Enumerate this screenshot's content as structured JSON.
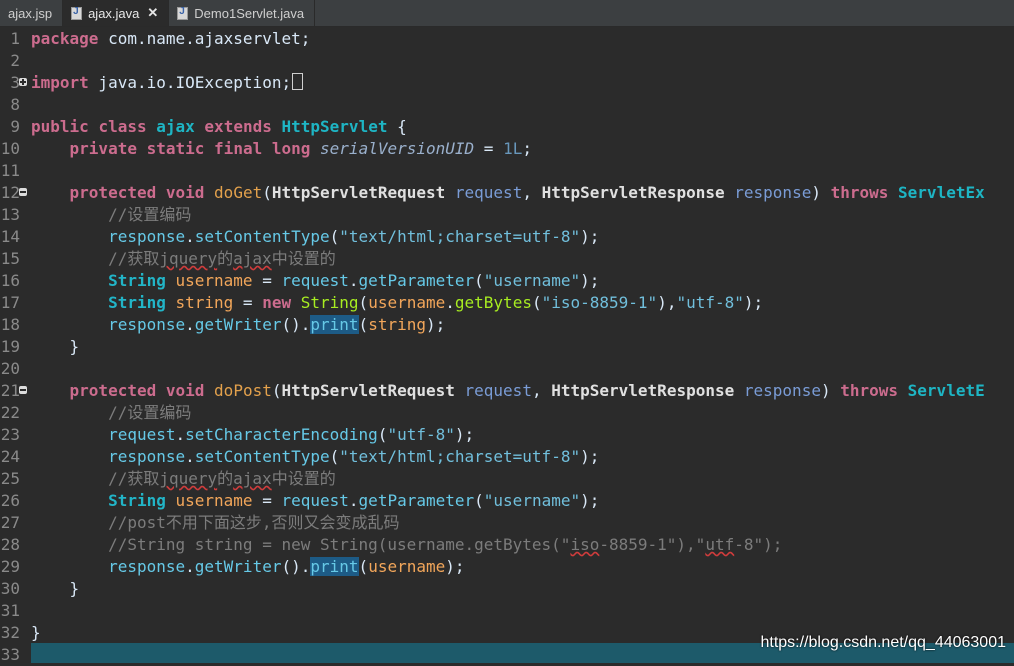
{
  "tabs": [
    {
      "label": "ajax.jsp",
      "active": false
    },
    {
      "label": "ajax.java",
      "active": true
    },
    {
      "label": "Demo1Servlet.java",
      "active": false
    }
  ],
  "line_numbers": [
    "1",
    "2",
    "3",
    "8",
    "9",
    "10",
    "11",
    "12",
    "13",
    "14",
    "15",
    "16",
    "17",
    "18",
    "19",
    "20",
    "21",
    "22",
    "23",
    "24",
    "25",
    "26",
    "27",
    "28",
    "29",
    "30",
    "31",
    "32",
    "33"
  ],
  "code": {
    "package_kw": "package",
    "package_name": " com.name.ajaxservlet;",
    "import_kw": "import",
    "import_name": " java.io.IOException;",
    "public_kw": "public",
    "class_kw": "class",
    "class_name": "ajax",
    "extends_kw": "extends",
    "super_class": "HttpServlet",
    "open_brace": " {",
    "private_kw": "private",
    "static_kw": "static",
    "final_kw": "final",
    "long_kw": "long",
    "field_name": "serialVersionUID",
    "assign": " = ",
    "field_value": "1L",
    "semi": ";",
    "protected_kw": "protected",
    "void_kw": "void",
    "doget": "doGet",
    "dopost": "doPost",
    "req_type": "HttpServletRequest",
    "req_name": "request",
    "resp_type": "HttpServletResponse",
    "resp_name": "response",
    "throws_kw": "throws",
    "throws_get": "ServletEx",
    "throws_post": "ServletE",
    "comment_encoding": "//设置编码",
    "comment_get_prefix": "//获取",
    "comment_get_jquery": "jquery",
    "comment_get_mid": "的",
    "comment_get_ajax": "ajax",
    "comment_get_suffix": "中设置的",
    "set_content_type": "setContentType",
    "content_type_str": "\"text/html;charset=utf-8\"",
    "string_type": "String",
    "username_var": "username",
    "string_var": "string",
    "get_parameter": "getParameter",
    "username_str": "\"username\"",
    "new_kw": "new",
    "get_bytes": "getBytes",
    "iso_str": "\"iso-8859-1\"",
    "utf8_str": "\"utf-8\"",
    "get_writer": "getWriter",
    "print": "print",
    "close_brace": "}",
    "set_char_enc": "setCharacterEncoding",
    "comment_post_note": "//post不用下面这步,否则又会变成乱码",
    "comment_disabled_a": "//String string = new String(username.getBytes(\"",
    "comment_disabled_iso": "iso",
    "comment_disabled_b": "-8859-1\"),\"",
    "comment_disabled_utf": "utf",
    "comment_disabled_c": "-8\");"
  },
  "watermark": "https://blog.csdn.net/qq_44063001",
  "icons": [
    "java-file-icon",
    "fold-collapse-icon",
    "fold-expand-icon",
    "close-icon"
  ]
}
